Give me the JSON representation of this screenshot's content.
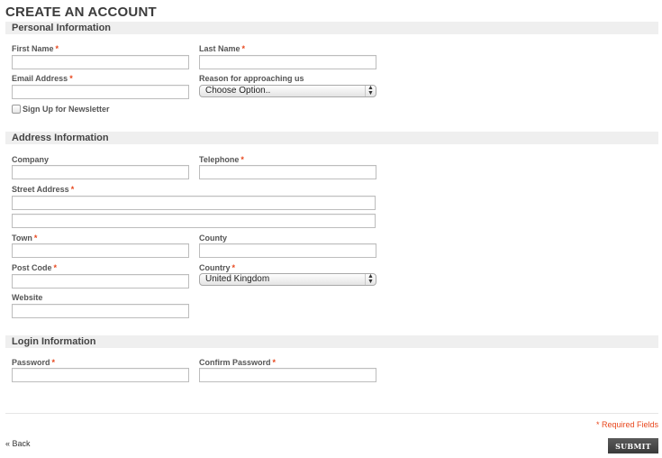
{
  "page": {
    "title": "CREATE AN ACCOUNT"
  },
  "sections": {
    "personal": {
      "title": "Personal Information",
      "first_name": {
        "label": "First Name",
        "value": ""
      },
      "last_name": {
        "label": "Last Name",
        "value": ""
      },
      "email": {
        "label": "Email Address",
        "value": ""
      },
      "reason": {
        "label": "Reason for approaching us",
        "selected": "Choose Option.."
      },
      "newsletter": {
        "label": "Sign Up for Newsletter",
        "checked": false
      }
    },
    "address": {
      "title": "Address Information",
      "company": {
        "label": "Company",
        "value": ""
      },
      "telephone": {
        "label": "Telephone",
        "value": ""
      },
      "street": {
        "label": "Street Address",
        "value1": "",
        "value2": ""
      },
      "town": {
        "label": "Town",
        "value": ""
      },
      "county": {
        "label": "County",
        "value": ""
      },
      "post_code": {
        "label": "Post Code",
        "value": ""
      },
      "country": {
        "label": "Country",
        "selected": "United Kingdom"
      },
      "website": {
        "label": "Website",
        "value": ""
      }
    },
    "login": {
      "title": "Login Information",
      "password": {
        "label": "Password",
        "value": ""
      },
      "confirm_password": {
        "label": "Confirm Password",
        "value": ""
      }
    }
  },
  "required_marker": "*",
  "footer": {
    "required_note": "* Required Fields",
    "back_label": "« Back",
    "submit_label": "SUBMIT"
  },
  "colors": {
    "required": "#e8471d",
    "section_bg": "#efefef",
    "submit_bg": "#4a4a4a"
  }
}
